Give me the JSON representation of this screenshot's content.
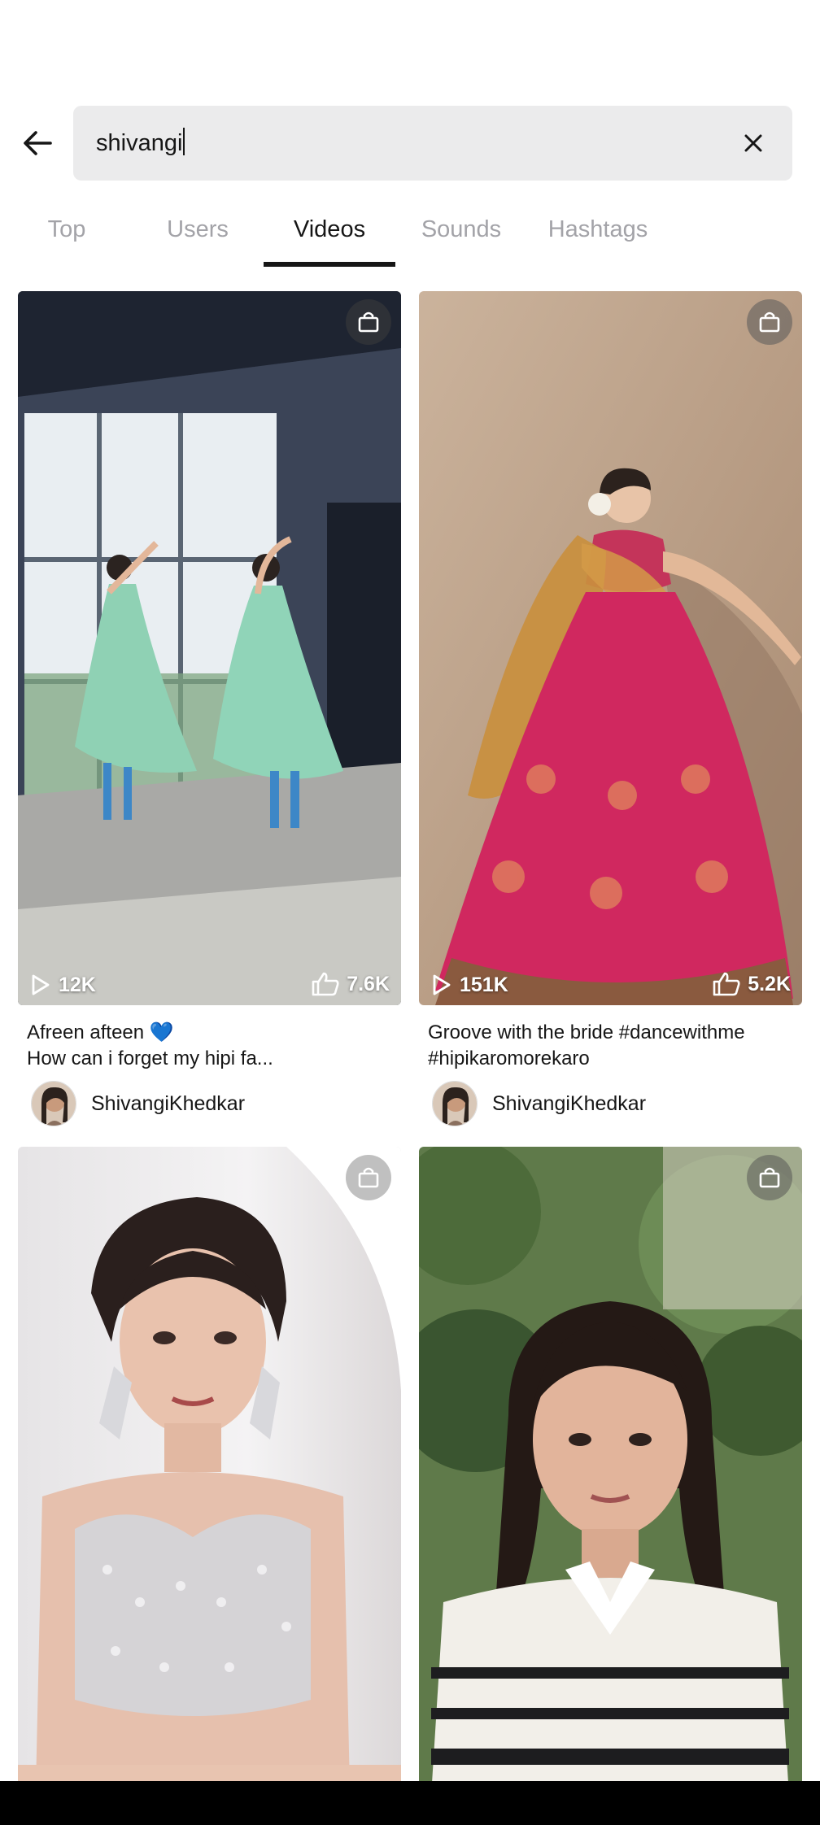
{
  "search": {
    "query": "shivangi"
  },
  "tabs": [
    {
      "label": "Top",
      "active": false
    },
    {
      "label": "Users",
      "active": false
    },
    {
      "label": "Videos",
      "active": true
    },
    {
      "label": "Sounds",
      "active": false
    },
    {
      "label": "Hashtags",
      "active": false
    }
  ],
  "videos": [
    {
      "views": "12K",
      "likes": "7.6K",
      "caption_line1": "Afreen afteen 💙",
      "caption_line2": "How can i forget my hipi fa...",
      "author": "ShivangiKhedkar"
    },
    {
      "views": "151K",
      "likes": "5.2K",
      "caption_line1": "Groove with the bride #dancewithme",
      "caption_line2": "#hipikaromorekaro",
      "author": "ShivangiKhedkar"
    },
    {
      "views": "",
      "likes": "",
      "caption_line1": "",
      "caption_line2": "",
      "author": ""
    },
    {
      "views": "",
      "likes": "",
      "caption_line1": "",
      "caption_line2": "",
      "author": ""
    }
  ],
  "colors": {
    "search_bg": "#ebebec",
    "tab_inactive": "#a3a3a8",
    "tab_active": "#161616"
  }
}
